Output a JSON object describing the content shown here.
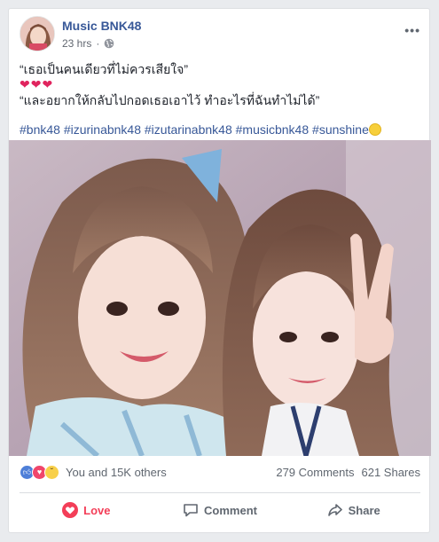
{
  "post": {
    "page_name": "Music BNK48",
    "time": "23 hrs",
    "separator": "·",
    "privacy_icon": "globe-icon",
    "more_icon": "more-icon",
    "text_line1": "“เธอเป็นคนเดียวที่ไม่ควรเสียใจ”",
    "hearts": "❤❤❤",
    "text_line2": "“และอยากให้กลับไปกอดเธอเอาไว้ ทำอะไรที่ฉันทำไม่ได้”",
    "hashtags": [
      "#bnk48",
      "#izurinabnk48",
      "#izutarinabnk48",
      "#musicbnk48",
      "#sunshine"
    ],
    "emoji_icon": "sun-emoji-icon"
  },
  "reactions": {
    "icons": [
      "like-icon",
      "love-icon",
      "sad-icon"
    ],
    "summary": "You and 15K others",
    "comments": "279 Comments",
    "shares": "621 Shares"
  },
  "actions": {
    "love_label": "Love",
    "comment_label": "Comment",
    "share_label": "Share"
  },
  "colors": {
    "link_blue": "#385898",
    "love_red": "#f33e58",
    "muted_gray": "#606770"
  }
}
